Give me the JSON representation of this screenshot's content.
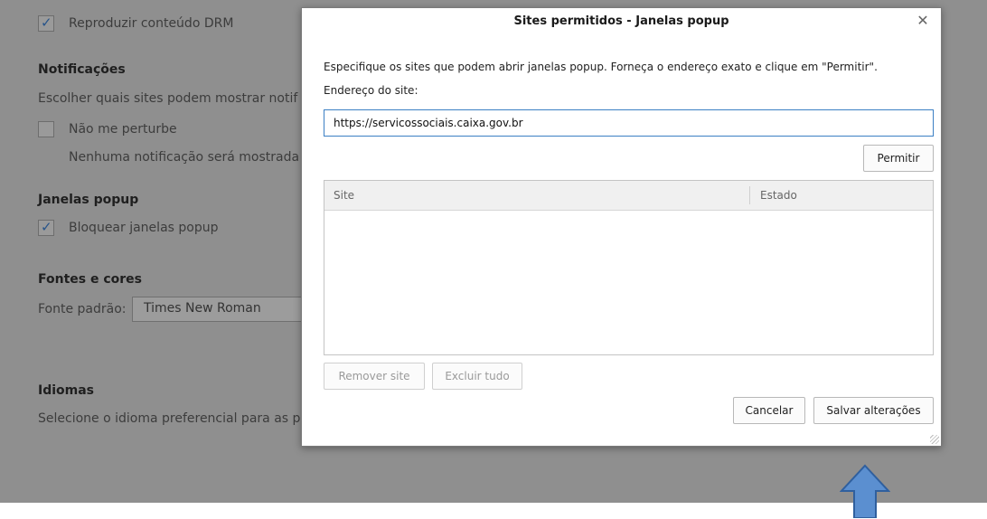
{
  "background": {
    "drm_label": "Reproduzir conteúdo DRM",
    "notifications_heading": "Notificações",
    "notifications_desc": "Escolher quais sites podem mostrar notif",
    "dnd_label": "Não me perturbe",
    "dnd_desc": "Nenhuma notificação será mostrada",
    "popups_heading": "Janelas popup",
    "block_popups_label": "Bloquear janelas popup",
    "fonts_heading": "Fontes e cores",
    "default_font_label": "Fonte padrão:",
    "default_font_value": "Times New Roman",
    "languages_heading": "Idiomas",
    "languages_desc": "Selecione o idioma preferencial para as p"
  },
  "dialog": {
    "title": "Sites permitidos - Janelas popup",
    "close_glyph": "✕",
    "description": "Especifique os sites que podem abrir janelas popup. Forneça o endereço exato e clique em \"Permitir\".",
    "address_label": "Endereço do site:",
    "address_value": "https://servicossociais.caixa.gov.br",
    "allow_button": "Permitir",
    "table": {
      "columns": [
        "Site",
        "Estado"
      ],
      "rows": []
    },
    "remove_site_button": "Remover site",
    "remove_all_button": "Excluir tudo",
    "cancel_button": "Cancelar",
    "save_button": "Salvar alterações"
  },
  "colors": {
    "overlay_gray": "#8f8f8f",
    "input_focus_border": "#3b7fc4",
    "arrow_fill": "#5b8fd0"
  },
  "icons": {
    "annotation": "up-arrow-icon"
  }
}
